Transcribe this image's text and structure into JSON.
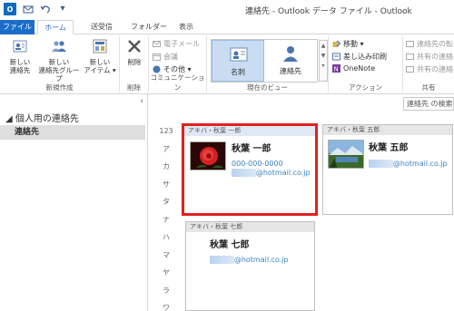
{
  "titlebar": {
    "app_logo": "O",
    "title": "連絡先 - Outlook データ ファイル - Outlook",
    "qat_icons": [
      "mail-icon",
      "undo-icon",
      "dropdown-icon"
    ]
  },
  "tabs": {
    "file": "ファイル",
    "home": "ホーム",
    "send_receive": "送受信",
    "folder": "フォルダー",
    "view": "表示"
  },
  "ribbon": {
    "new_group": {
      "label": "新規作成",
      "new_contact": [
        "新しい",
        "連絡先"
      ],
      "new_group_btn": [
        "新しい",
        "連絡先グループ"
      ],
      "new_item": [
        "新しい",
        "アイテム ▾"
      ]
    },
    "delete_group": {
      "label": "削除",
      "delete": "削除"
    },
    "comm_group": {
      "label": "コミュニケーション",
      "email": "電子メール",
      "meeting": "会議",
      "more": "その他 ▾"
    },
    "view_group": {
      "label": "現在のビュー",
      "business_card": "名刺",
      "contact": "連絡先"
    },
    "action_group": {
      "label": "アクション",
      "move": "移動 ▾",
      "mail_merge": "差し込み印刷",
      "onenote": "OneNote"
    },
    "share_group": {
      "label": "共有",
      "forward": "連絡先の転",
      "share": "共有の連絡",
      "open_shared": "共有の連絡"
    }
  },
  "nav": {
    "collapse_glyph": "‹",
    "header": "◢ 個人用の連絡先",
    "item": "連絡先"
  },
  "search": {
    "placeholder": "連絡先 の検索"
  },
  "index_letters": [
    "123",
    "ア",
    "カ",
    "サ",
    "タ",
    "ナ",
    "ハ",
    "マ",
    "ヤ",
    "ラ",
    "ワ"
  ],
  "cards": [
    {
      "header": "アキバ・秋葉 一郎",
      "name": "秋葉 一郎",
      "phone": "000-000-0000",
      "email_hidden": "akiba1",
      "email_domain": "@hotmail.co.jp"
    },
    {
      "header": "アキバ・秋葉 五郎",
      "name": "秋葉 五郎",
      "email_hidden": "akiba5",
      "email_domain": "@hotmail.co.jp"
    },
    {
      "header": "アキバ・秋葉 七郎",
      "name": "秋葉 七郎",
      "email_hidden": "akiba7",
      "email_domain": "@hotmail.co.jp"
    }
  ],
  "colors": {
    "accent": "#1c6dc9",
    "selection_border": "#e02020",
    "link": "#3b82c4"
  }
}
